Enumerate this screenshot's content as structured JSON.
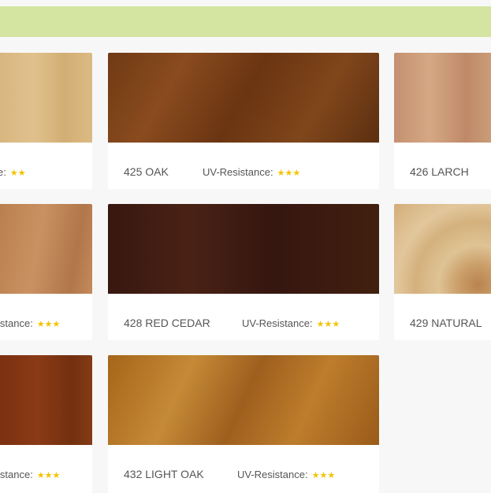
{
  "header": {
    "bar_color": "#d3e5a0"
  },
  "uv_label": "UV-Resistance:",
  "cards": [
    {
      "name": "",
      "uv_label": "e:",
      "stars": "★★",
      "rating": 2
    },
    {
      "name": "425 OAK",
      "stars": "★★★",
      "rating": 3
    },
    {
      "name": "426 LARCH",
      "rating": null
    },
    {
      "name": "",
      "uv_label": "istance:",
      "stars": "★★★",
      "rating": 3
    },
    {
      "name": "428 RED CEDAR",
      "stars": "★★★",
      "rating": 3
    },
    {
      "name": "429 NATURAL",
      "rating": null
    },
    {
      "name": "",
      "uv_label": "istance:",
      "stars": "★★★",
      "rating": 3
    },
    {
      "name": "432 LIGHT OAK",
      "stars": "★★★",
      "rating": 3
    }
  ],
  "colors": {
    "star": "#f2c300",
    "swatch_1": "#d8b47f",
    "swatch_425": "#7a4318",
    "swatch_426": "#c69270",
    "swatch_4": "#c08452",
    "swatch_428": "#3b1a0f",
    "swatch_429": "#d9b98a",
    "swatch_7": "#7f3411",
    "swatch_432": "#a8691c"
  }
}
